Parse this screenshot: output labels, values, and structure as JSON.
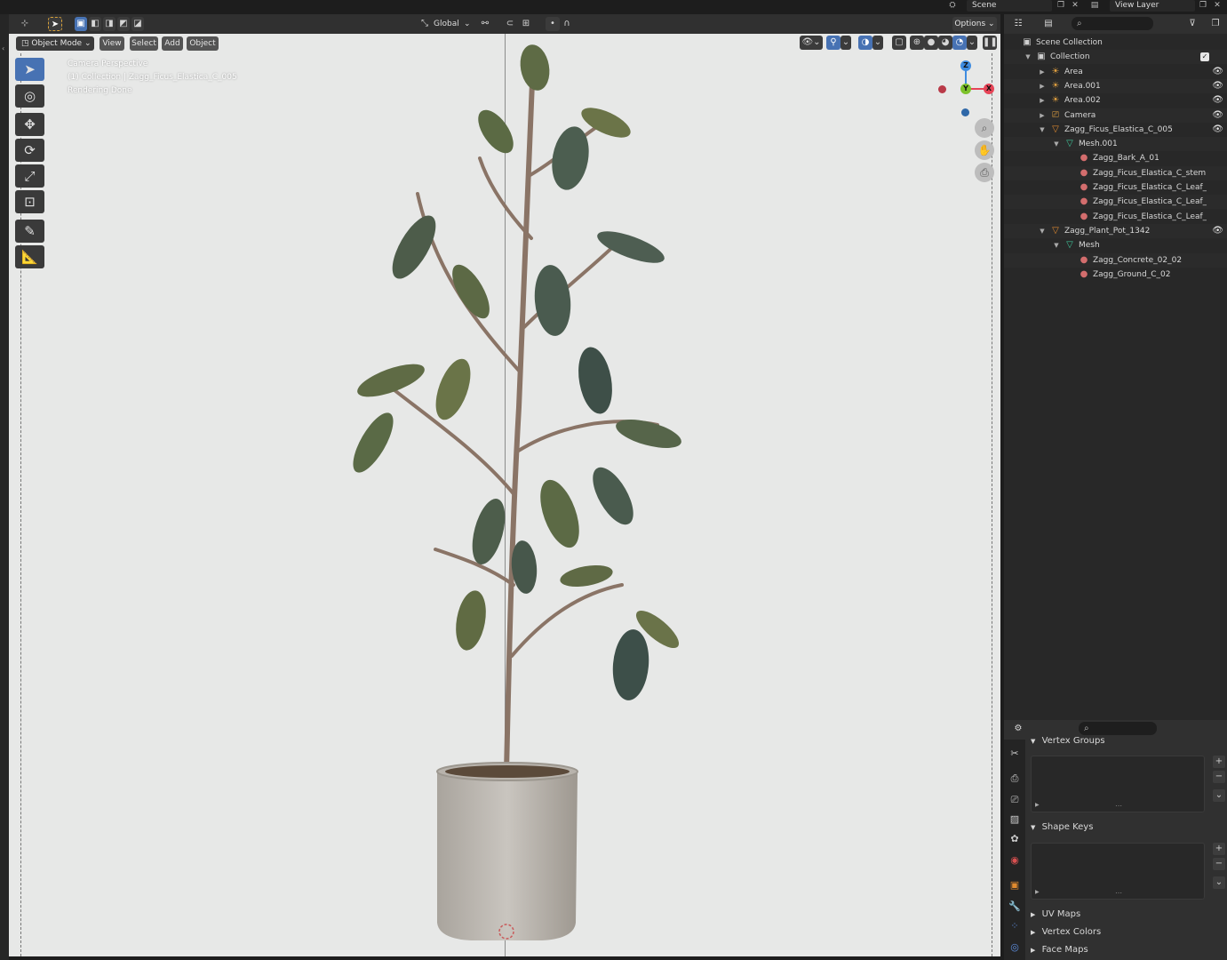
{
  "topbar": {
    "scene_label": "Scene",
    "view_layer_label": "View Layer"
  },
  "viewport_header": {
    "mode_label": "Object Mode",
    "menus": [
      "View",
      "Select",
      "Add",
      "Object"
    ],
    "transform_orientation": "Global",
    "options_label": "Options"
  },
  "viewport_overlay": {
    "line1": "Camera Perspective",
    "line2": "(1) Collection | Zagg_Ficus_Elastica_C_005",
    "line3": "Rendering Done"
  },
  "gizmo": {
    "z": "Z",
    "y": "Y",
    "x": "X"
  },
  "outliner": {
    "rows": [
      {
        "name": "Scene Collection",
        "indent": 0,
        "icon": "collection-icon",
        "tri": "",
        "eye": false
      },
      {
        "name": "Collection",
        "indent": 1,
        "icon": "collection-icon",
        "tri": "▼",
        "eye": false
      },
      {
        "name": "Area",
        "indent": 2,
        "icon": "light-icon",
        "tri": "▶",
        "eye": true
      },
      {
        "name": "Area.001",
        "indent": 2,
        "icon": "light-icon",
        "tri": "▶",
        "eye": true
      },
      {
        "name": "Area.002",
        "indent": 2,
        "icon": "light-icon",
        "tri": "▶",
        "eye": true
      },
      {
        "name": "Camera",
        "indent": 2,
        "icon": "camera-icon",
        "tri": "▶",
        "eye": true
      },
      {
        "name": "Zagg_Ficus_Elastica_C_005",
        "indent": 2,
        "icon": "mesh-object-icon",
        "tri": "▼",
        "eye": true
      },
      {
        "name": "Mesh.001",
        "indent": 3,
        "icon": "mesh-data-icon",
        "tri": "▼",
        "eye": false
      },
      {
        "name": "Zagg_Bark_A_01",
        "indent": 4,
        "icon": "material-icon",
        "tri": "",
        "eye": false
      },
      {
        "name": "Zagg_Ficus_Elastica_C_stem",
        "indent": 4,
        "icon": "material-icon",
        "tri": "",
        "eye": false
      },
      {
        "name": "Zagg_Ficus_Elastica_C_Leaf_",
        "indent": 4,
        "icon": "material-icon",
        "tri": "",
        "eye": false
      },
      {
        "name": "Zagg_Ficus_Elastica_C_Leaf_",
        "indent": 4,
        "icon": "material-icon",
        "tri": "",
        "eye": false
      },
      {
        "name": "Zagg_Ficus_Elastica_C_Leaf_",
        "indent": 4,
        "icon": "material-icon",
        "tri": "",
        "eye": false
      },
      {
        "name": "Zagg_Plant_Pot_1342",
        "indent": 2,
        "icon": "mesh-object-icon",
        "tri": "▼",
        "eye": true
      },
      {
        "name": "Mesh",
        "indent": 3,
        "icon": "mesh-data-icon",
        "tri": "▼",
        "eye": false
      },
      {
        "name": "Zagg_Concrete_02_02",
        "indent": 4,
        "icon": "material-icon",
        "tri": "",
        "eye": false
      },
      {
        "name": "Zagg_Ground_C_02",
        "indent": 4,
        "icon": "material-icon",
        "tri": "",
        "eye": false
      }
    ]
  },
  "properties": {
    "vertex_groups_label": "Vertex Groups",
    "shape_keys_label": "Shape Keys",
    "uv_maps_label": "UV Maps",
    "vertex_colors_label": "Vertex Colors",
    "face_maps_label": "Face Maps"
  },
  "colors": {
    "accent": "#4772b3",
    "axis_x": "#e64457",
    "axis_y": "#7dc22a",
    "axis_z": "#3f8ce0"
  }
}
